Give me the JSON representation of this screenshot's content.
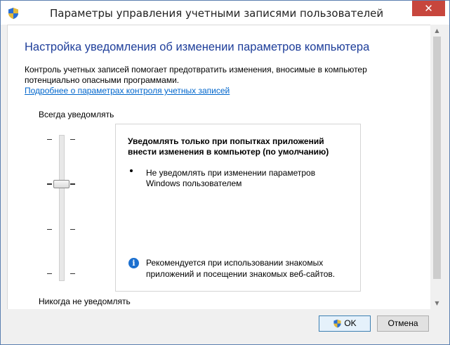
{
  "window": {
    "title": "Параметры управления учетными записями пользователей",
    "close_label": "✕"
  },
  "heading": "Настройка уведомления об изменении параметров компьютера",
  "description": "Контроль учетных записей помогает предотвратить изменения, вносимые в компьютер потенциально опасными программами.",
  "link": "Подробнее о параметрах контроля учетных записей",
  "slider": {
    "top_label": "Всегда уведомлять",
    "bottom_label": "Никогда не уведомлять",
    "levels": 4,
    "selected_level": 2
  },
  "panel": {
    "title": "Уведомлять только при попытках приложений внести изменения в компьютер (по умолчанию)",
    "bullets": [
      "Не уведомлять при изменении параметров Windows пользователем"
    ],
    "info": "Рекомендуется при использовании знакомых приложений и посещении знакомых веб-сайтов."
  },
  "buttons": {
    "ok": "OK",
    "cancel": "Отмена"
  },
  "icons": {
    "title_icon": "uac-shield-icon",
    "ok_icon": "uac-shield-icon",
    "info_icon": "info-icon"
  },
  "colors": {
    "heading": "#1e3e9a",
    "link": "#0066cc",
    "close": "#c7463d",
    "info": "#1b6fcf"
  }
}
